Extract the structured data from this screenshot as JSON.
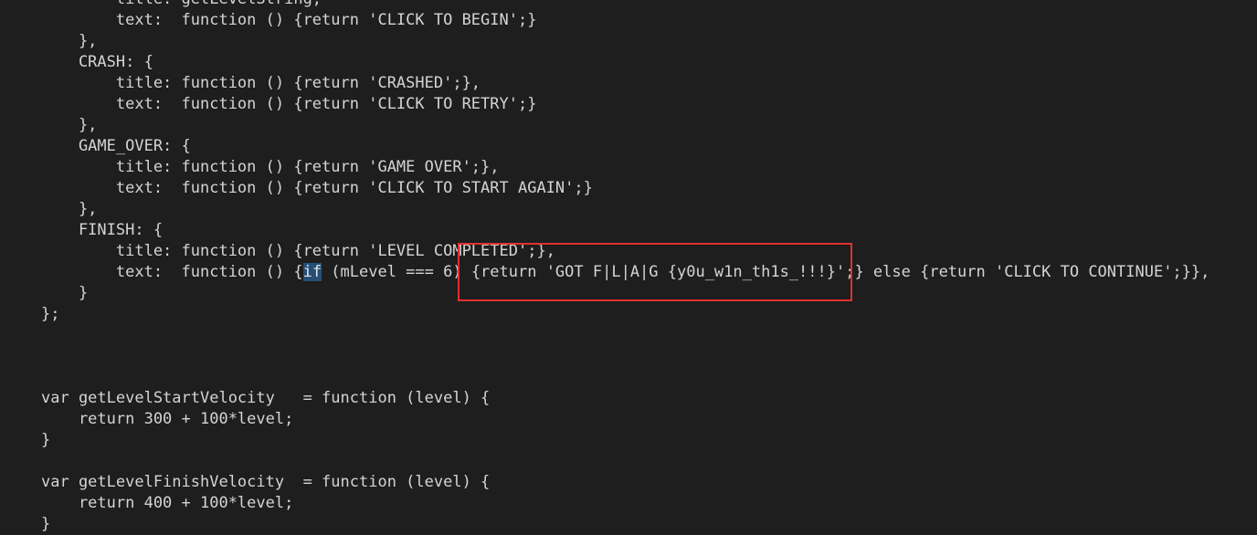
{
  "editor": {
    "lines": [
      "        title: getLevelString,",
      "        text:  function () {return 'CLICK TO BEGIN';}",
      "    },",
      "    CRASH: {",
      "        title: function () {return 'CRASHED';},",
      "        text:  function () {return 'CLICK TO RETRY';}",
      "    },",
      "    GAME_OVER: {",
      "        title: function () {return 'GAME OVER';},",
      "        text:  function () {return 'CLICK TO START AGAIN';}",
      "    },",
      "    FINISH: {",
      "        title: function () {return 'LEVEL COMPLETED';},",
      "        text:  function () {",
      "    }",
      "};",
      "",
      "",
      "",
      "var getLevelStartVelocity   = function (level) {",
      "    return 300 + 100*level;",
      "}",
      "",
      "var getLevelFinishVelocity  = function (level) {",
      "    return 400 + 100*level;",
      "}"
    ],
    "finish_text_line": {
      "prefix": "        text:  function () {",
      "keyword": "if",
      "suffix": " (mLevel === 6) {return 'GOT F|L|A|G {y0u_w1n_th1s_!!!}';} else {return 'CLICK TO CONTINUE';}},"
    }
  },
  "annotation": {
    "color": "#e0302e"
  }
}
